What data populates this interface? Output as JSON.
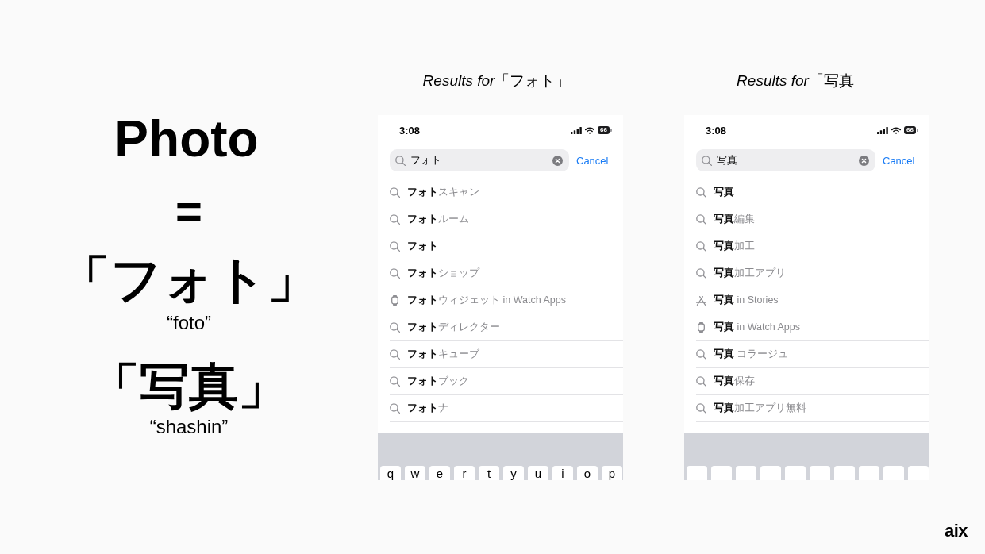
{
  "headword": "Photo",
  "equals_sign": "=",
  "translations": [
    {
      "word": "「フォト」",
      "reading": "“foto”"
    },
    {
      "word": "「写真」",
      "reading": "“shashin”"
    }
  ],
  "panels": [
    {
      "title": "*Results for*「フォト」",
      "phone": {
        "time": "3:08",
        "battery": "66",
        "search": {
          "value": "フォト",
          "action": "Cancel"
        },
        "suggestions": [
          {
            "kind": "search",
            "match": "フォト",
            "rest": "スキャン"
          },
          {
            "kind": "search",
            "match": "フォト",
            "rest": "ルーム"
          },
          {
            "kind": "search",
            "match": "フォト"
          },
          {
            "kind": "search",
            "match": "フォト",
            "rest": "ショップ"
          },
          {
            "kind": "watch",
            "match": "フォト",
            "rest": "ウィジェット in Watch Apps"
          },
          {
            "kind": "search",
            "match": "フォト",
            "rest": "ディレクター"
          },
          {
            "kind": "search",
            "match": "フォト",
            "rest": "キューブ"
          },
          {
            "kind": "search",
            "match": "フォト",
            "rest": "ブック"
          },
          {
            "kind": "search",
            "match": "フォト",
            "rest": "ナ"
          }
        ],
        "keyboard": {
          "keys": [
            "q",
            "w",
            "e",
            "r",
            "t",
            "y",
            "u",
            "i",
            "o",
            "p"
          ]
        }
      }
    },
    {
      "title": "*Results for*「写真」",
      "phone": {
        "time": "3:08",
        "battery": "66",
        "search": {
          "value": "写真",
          "action": "Cancel"
        },
        "suggestions": [
          {
            "kind": "search",
            "match": "写真"
          },
          {
            "kind": "search",
            "match": "写真",
            "rest": "編集"
          },
          {
            "kind": "search",
            "match": "写真",
            "rest": "加工"
          },
          {
            "kind": "search",
            "match": "写真",
            "rest": "加工アプリ"
          },
          {
            "kind": "stories",
            "match": "写真",
            "rest": " in Stories"
          },
          {
            "kind": "watch",
            "match": "写真",
            "rest": " in Watch Apps"
          },
          {
            "kind": "search",
            "match": "写真",
            "rest": " コラージュ"
          },
          {
            "kind": "search",
            "match": "写真",
            "rest": "保存"
          },
          {
            "kind": "search",
            "match": "写真",
            "rest": "加工アプリ無料"
          }
        ]
      }
    }
  ],
  "logo": "aix"
}
